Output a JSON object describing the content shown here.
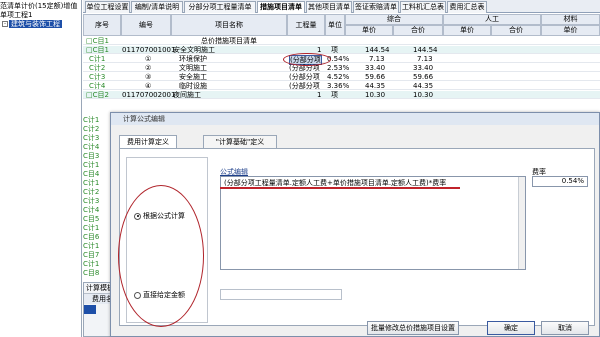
{
  "tree": {
    "line1": "范清单计价(15定额)增值",
    "line2": "单项工程1",
    "selected": "建筑与装饰工程"
  },
  "tabs": [
    "单位工程设置",
    "编制/清单说明",
    "分部分项工程量清单",
    "措施项目清单",
    "其他项目清单",
    "签证索赔清单",
    "工料机汇总表",
    "费用汇总表"
  ],
  "grid": {
    "headers": {
      "seq": "序号",
      "code": "编号",
      "name": "项目名称",
      "qty": "工程量",
      "unit": "单位",
      "comp": "综合",
      "labor": "人工",
      "mat": "材料",
      "price": "单价",
      "total": "合价"
    },
    "rows": [
      {
        "seq": "□C目1",
        "code": "",
        "name": "总价措施项目清单",
        "qty": "",
        "unit": "",
        "p": "",
        "t": "",
        "lp": "",
        "lt": "",
        "mp": ""
      },
      {
        "seq": "□C目1",
        "code": "011707001001",
        "name": "安全文明施工",
        "qty": "1",
        "unit": "项",
        "p": "144.54",
        "t": "144.54",
        "lp": "",
        "lt": "",
        "mp": ""
      },
      {
        "seq": "C计1",
        "code": "①",
        "name": "环境保护",
        "qty": "(分部分项",
        "unit": "0.54%",
        "p": "7.13",
        "t": "7.13",
        "lp": "",
        "lt": "",
        "mp": ""
      },
      {
        "seq": "C计2",
        "code": "②",
        "name": "文明施工",
        "qty": "(分部分项",
        "unit": "2.53%",
        "p": "33.40",
        "t": "33.40",
        "lp": "",
        "lt": "",
        "mp": ""
      },
      {
        "seq": "C计3",
        "code": "③",
        "name": "安全施工",
        "qty": "(分部分项",
        "unit": "4.52%",
        "p": "59.66",
        "t": "59.66",
        "lp": "",
        "lt": "",
        "mp": ""
      },
      {
        "seq": "C计4",
        "code": "④",
        "name": "临时设施",
        "qty": "(分部分项",
        "unit": "3.36%",
        "p": "44.35",
        "t": "44.35",
        "lp": "",
        "lt": "",
        "mp": ""
      },
      {
        "seq": "□C目2",
        "code": "011707002001",
        "name": "夜间施工",
        "qty": "1",
        "unit": "项",
        "p": "10.30",
        "t": "10.30",
        "lp": "",
        "lt": "",
        "mp": ""
      }
    ],
    "left_rows": [
      "C计1",
      "C计2",
      "C计3",
      "C计4",
      "C目3",
      "C计1",
      "C目4",
      "C计1",
      "C计2",
      "C计3",
      "C计4",
      "C目5",
      "C计1",
      "C目6",
      "C计1",
      "C目7",
      "C计1",
      "C目8",
      "C计1",
      "C计2",
      "C计3"
    ]
  },
  "template": {
    "title": "计算模板",
    "col": "费用名称"
  },
  "dialog": {
    "title": "计算公式编辑",
    "tab1": "费用计算定义",
    "tab2": "\"计算基础\"定义",
    "formula_label": "公式编辑",
    "rate_label": "费率",
    "formula": "(分部分项工程量清单.定额人工费+单价措施项目清单.定额人工费)*费率",
    "rate": "0.54%",
    "radio1": "根据公式计算",
    "radio2": "直接给定金额",
    "btn_batch": "批量修改总价措施项目设置",
    "btn_ok": "确定",
    "btn_cancel": "取消"
  }
}
